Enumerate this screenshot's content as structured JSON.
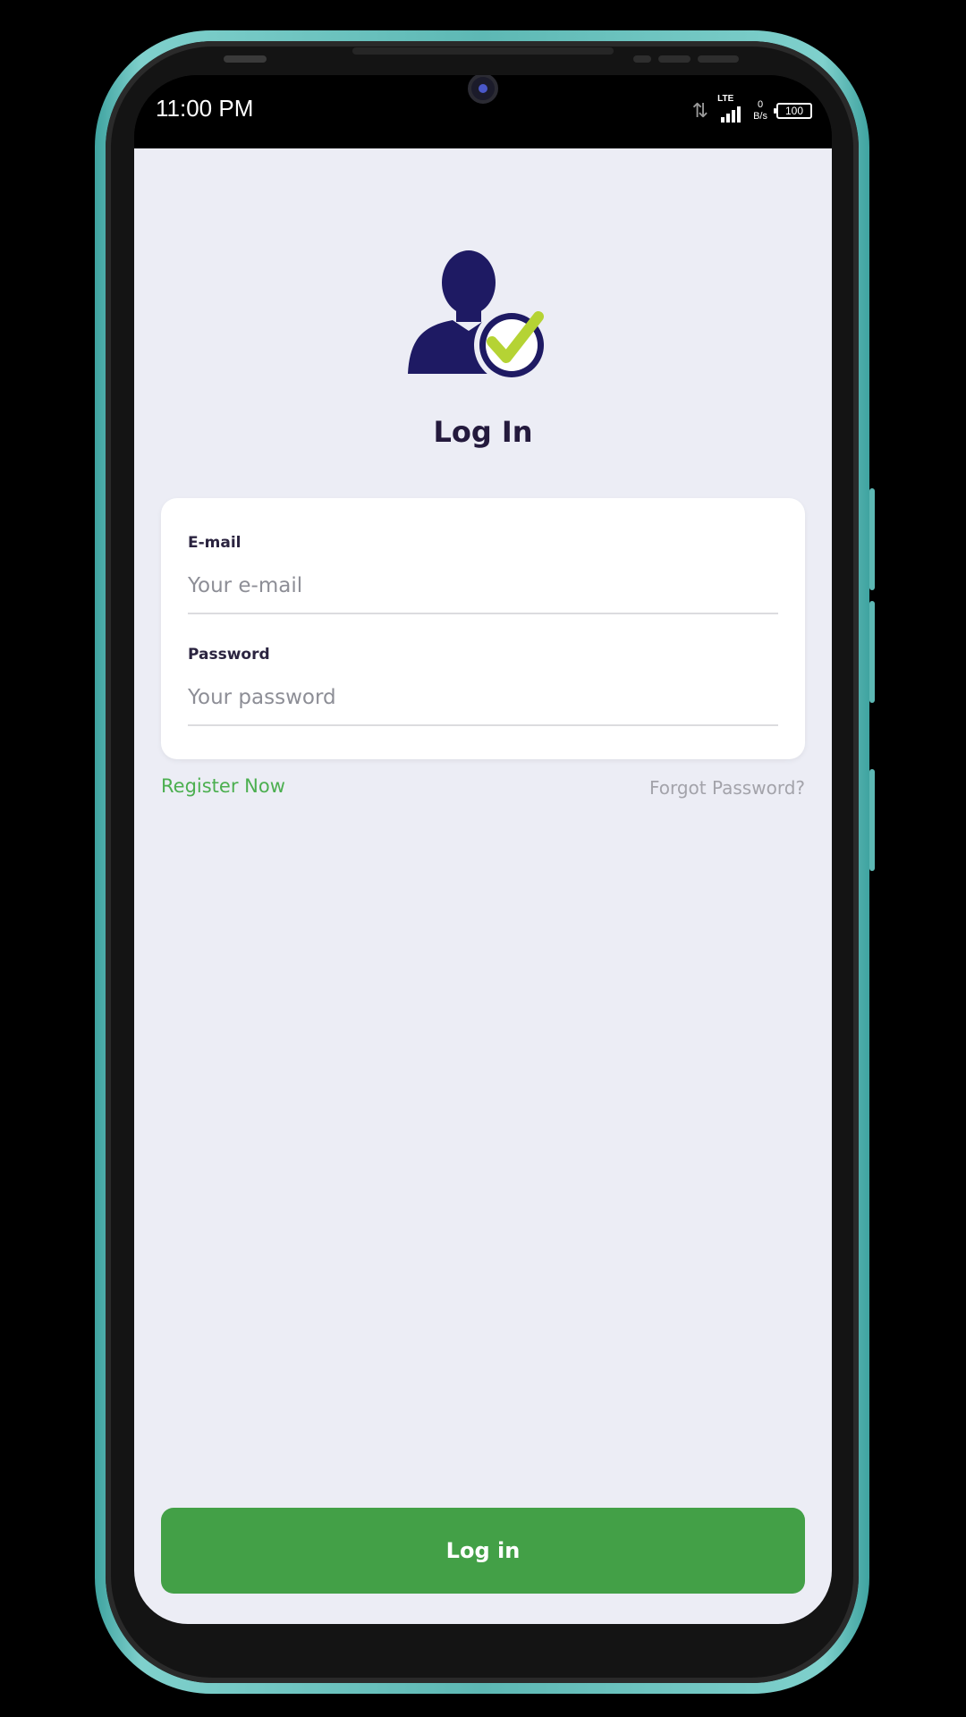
{
  "status_bar": {
    "time": "11:00 PM",
    "network_type": "LTE",
    "net_speed_value": "0",
    "net_speed_unit": "B/s",
    "battery_level": "100"
  },
  "login": {
    "title": "Log In",
    "email_label": "E-mail",
    "email_placeholder": "Your e-mail",
    "password_label": "Password",
    "password_placeholder": "Your password",
    "register_link": "Register Now",
    "forgot_link": "Forgot Password?",
    "submit_label": "Log in"
  },
  "icons": {
    "logo": "user-check-icon",
    "nav_recents": "recents-icon",
    "nav_home": "home-circle-icon",
    "nav_back": "back-icon"
  },
  "colors": {
    "background": "#ecedf5",
    "accent_green": "#43a047",
    "link_green": "#4caf50",
    "title_dark": "#241a3d",
    "logo_navy": "#1e1a63",
    "logo_check": "#b5d334",
    "frame_teal": "#5db8b4"
  }
}
